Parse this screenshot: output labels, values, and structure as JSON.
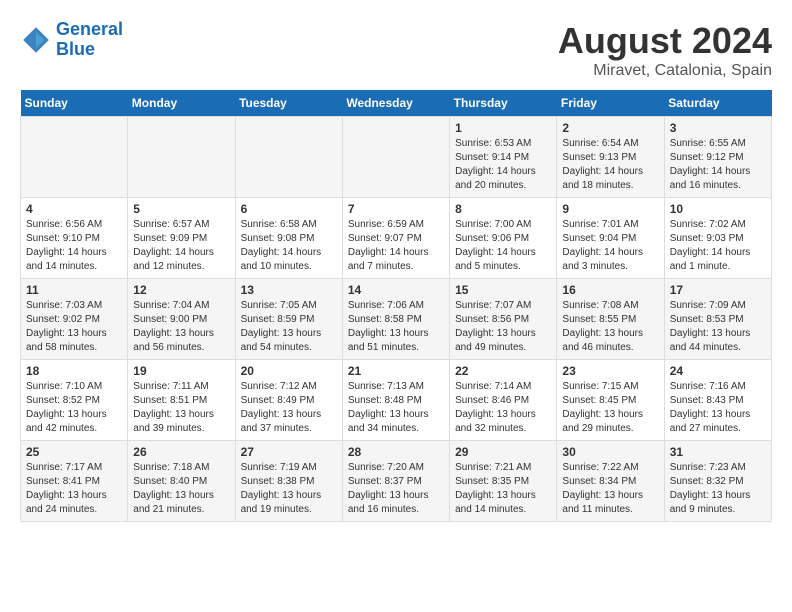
{
  "header": {
    "logo_line1": "General",
    "logo_line2": "Blue",
    "title": "August 2024",
    "subtitle": "Miravet, Catalonia, Spain"
  },
  "days_of_week": [
    "Sunday",
    "Monday",
    "Tuesday",
    "Wednesday",
    "Thursday",
    "Friday",
    "Saturday"
  ],
  "weeks": [
    [
      {
        "day": "",
        "info": ""
      },
      {
        "day": "",
        "info": ""
      },
      {
        "day": "",
        "info": ""
      },
      {
        "day": "",
        "info": ""
      },
      {
        "day": "1",
        "info": "Sunrise: 6:53 AM\nSunset: 9:14 PM\nDaylight: 14 hours and 20 minutes."
      },
      {
        "day": "2",
        "info": "Sunrise: 6:54 AM\nSunset: 9:13 PM\nDaylight: 14 hours and 18 minutes."
      },
      {
        "day": "3",
        "info": "Sunrise: 6:55 AM\nSunset: 9:12 PM\nDaylight: 14 hours and 16 minutes."
      }
    ],
    [
      {
        "day": "4",
        "info": "Sunrise: 6:56 AM\nSunset: 9:10 PM\nDaylight: 14 hours and 14 minutes."
      },
      {
        "day": "5",
        "info": "Sunrise: 6:57 AM\nSunset: 9:09 PM\nDaylight: 14 hours and 12 minutes."
      },
      {
        "day": "6",
        "info": "Sunrise: 6:58 AM\nSunset: 9:08 PM\nDaylight: 14 hours and 10 minutes."
      },
      {
        "day": "7",
        "info": "Sunrise: 6:59 AM\nSunset: 9:07 PM\nDaylight: 14 hours and 7 minutes."
      },
      {
        "day": "8",
        "info": "Sunrise: 7:00 AM\nSunset: 9:06 PM\nDaylight: 14 hours and 5 minutes."
      },
      {
        "day": "9",
        "info": "Sunrise: 7:01 AM\nSunset: 9:04 PM\nDaylight: 14 hours and 3 minutes."
      },
      {
        "day": "10",
        "info": "Sunrise: 7:02 AM\nSunset: 9:03 PM\nDaylight: 14 hours and 1 minute."
      }
    ],
    [
      {
        "day": "11",
        "info": "Sunrise: 7:03 AM\nSunset: 9:02 PM\nDaylight: 13 hours and 58 minutes."
      },
      {
        "day": "12",
        "info": "Sunrise: 7:04 AM\nSunset: 9:00 PM\nDaylight: 13 hours and 56 minutes."
      },
      {
        "day": "13",
        "info": "Sunrise: 7:05 AM\nSunset: 8:59 PM\nDaylight: 13 hours and 54 minutes."
      },
      {
        "day": "14",
        "info": "Sunrise: 7:06 AM\nSunset: 8:58 PM\nDaylight: 13 hours and 51 minutes."
      },
      {
        "day": "15",
        "info": "Sunrise: 7:07 AM\nSunset: 8:56 PM\nDaylight: 13 hours and 49 minutes."
      },
      {
        "day": "16",
        "info": "Sunrise: 7:08 AM\nSunset: 8:55 PM\nDaylight: 13 hours and 46 minutes."
      },
      {
        "day": "17",
        "info": "Sunrise: 7:09 AM\nSunset: 8:53 PM\nDaylight: 13 hours and 44 minutes."
      }
    ],
    [
      {
        "day": "18",
        "info": "Sunrise: 7:10 AM\nSunset: 8:52 PM\nDaylight: 13 hours and 42 minutes."
      },
      {
        "day": "19",
        "info": "Sunrise: 7:11 AM\nSunset: 8:51 PM\nDaylight: 13 hours and 39 minutes."
      },
      {
        "day": "20",
        "info": "Sunrise: 7:12 AM\nSunset: 8:49 PM\nDaylight: 13 hours and 37 minutes."
      },
      {
        "day": "21",
        "info": "Sunrise: 7:13 AM\nSunset: 8:48 PM\nDaylight: 13 hours and 34 minutes."
      },
      {
        "day": "22",
        "info": "Sunrise: 7:14 AM\nSunset: 8:46 PM\nDaylight: 13 hours and 32 minutes."
      },
      {
        "day": "23",
        "info": "Sunrise: 7:15 AM\nSunset: 8:45 PM\nDaylight: 13 hours and 29 minutes."
      },
      {
        "day": "24",
        "info": "Sunrise: 7:16 AM\nSunset: 8:43 PM\nDaylight: 13 hours and 27 minutes."
      }
    ],
    [
      {
        "day": "25",
        "info": "Sunrise: 7:17 AM\nSunset: 8:41 PM\nDaylight: 13 hours and 24 minutes."
      },
      {
        "day": "26",
        "info": "Sunrise: 7:18 AM\nSunset: 8:40 PM\nDaylight: 13 hours and 21 minutes."
      },
      {
        "day": "27",
        "info": "Sunrise: 7:19 AM\nSunset: 8:38 PM\nDaylight: 13 hours and 19 minutes."
      },
      {
        "day": "28",
        "info": "Sunrise: 7:20 AM\nSunset: 8:37 PM\nDaylight: 13 hours and 16 minutes."
      },
      {
        "day": "29",
        "info": "Sunrise: 7:21 AM\nSunset: 8:35 PM\nDaylight: 13 hours and 14 minutes."
      },
      {
        "day": "30",
        "info": "Sunrise: 7:22 AM\nSunset: 8:34 PM\nDaylight: 13 hours and 11 minutes."
      },
      {
        "day": "31",
        "info": "Sunrise: 7:23 AM\nSunset: 8:32 PM\nDaylight: 13 hours and 9 minutes."
      }
    ]
  ]
}
